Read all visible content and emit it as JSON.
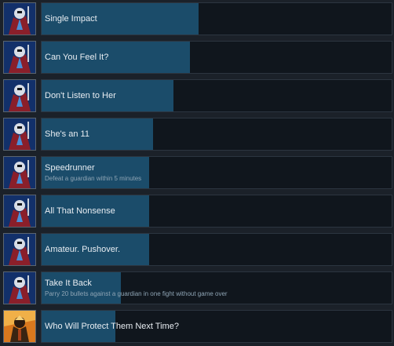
{
  "achievements": [
    {
      "title": "Single Impact",
      "description": "",
      "progress": 0.45,
      "icon": "knight-icon",
      "locked": false
    },
    {
      "title": "Can You Feel It?",
      "description": "",
      "progress": 0.42,
      "icon": "knight-icon",
      "locked": false
    },
    {
      "title": "Don't Listen to Her",
      "description": "",
      "progress": 0.38,
      "icon": "knight-icon",
      "locked": false
    },
    {
      "title": "She's an 11",
      "description": "",
      "progress": 0.32,
      "icon": "knight-icon",
      "locked": false
    },
    {
      "title": "Speedrunner",
      "description": "Defeat a guardian within 5 minutes",
      "progress": 0.31,
      "icon": "knight-icon",
      "locked": false
    },
    {
      "title": "All That Nonsense",
      "description": "",
      "progress": 0.31,
      "icon": "knight-icon",
      "locked": false
    },
    {
      "title": "Amateur. Pushover.",
      "description": "",
      "progress": 0.31,
      "icon": "knight-icon",
      "locked": false
    },
    {
      "title": "Take It Back",
      "description": "Parry 20 bullets against a guardian in one fight without game over",
      "progress": 0.23,
      "icon": "knight-icon",
      "locked": false
    },
    {
      "title": "Who Will Protect Them Next Time?",
      "description": "",
      "progress": 0.21,
      "icon": "guardian-icon",
      "locked": false
    }
  ],
  "colors": {
    "background": "#1b2129",
    "bar_fill": "#1b4c6a",
    "bar_track": "#10161d",
    "title_text": "#e8edf2",
    "description_text": "#8ea4b4"
  }
}
